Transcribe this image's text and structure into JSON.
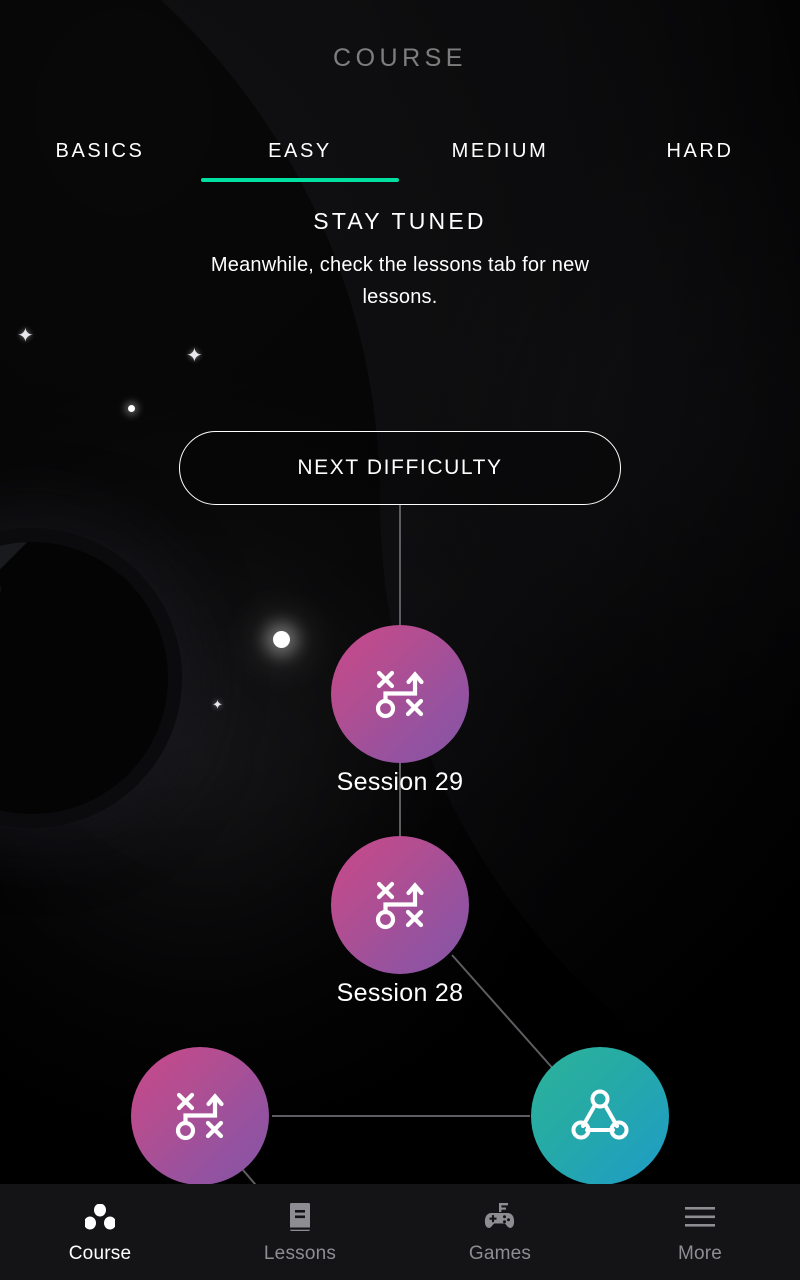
{
  "header": {
    "title": "COURSE"
  },
  "tabs": [
    {
      "label": "BASICS",
      "active": false
    },
    {
      "label": "EASY",
      "active": true
    },
    {
      "label": "MEDIUM",
      "active": false
    },
    {
      "label": "HARD",
      "active": false
    }
  ],
  "banner": {
    "title": "STAY TUNED",
    "subtitle": "Meanwhile, check the lessons tab for new lessons."
  },
  "next_difficulty_button": {
    "label": "NEXT DIFFICULTY"
  },
  "nodes": [
    {
      "label": "Session 29",
      "icon": "tactics-playbook-icon",
      "color": "purple"
    },
    {
      "label": "Session 28",
      "icon": "tactics-playbook-icon",
      "color": "purple"
    },
    {
      "label": "",
      "icon": "tactics-playbook-icon",
      "color": "purple"
    },
    {
      "label": "",
      "icon": "network-triangle-icon",
      "color": "teal"
    }
  ],
  "bottom_nav": [
    {
      "label": "Course",
      "icon": "three-dots-icon",
      "active": true
    },
    {
      "label": "Lessons",
      "icon": "book-icon",
      "active": false
    },
    {
      "label": "Games",
      "icon": "gamepad-icon",
      "active": false
    },
    {
      "label": "More",
      "icon": "hamburger-icon",
      "active": false
    }
  ],
  "colors": {
    "background": "#000000",
    "accent": "#00e0a0",
    "node_purple_start": "#c9488a",
    "node_purple_end": "#8455a6",
    "node_teal_start": "#2cb39a",
    "node_teal_end": "#1f9cc8",
    "nav_bar": "#141416",
    "nav_inactive": "#8d8d92",
    "connector_line": "#5a5a5e"
  }
}
